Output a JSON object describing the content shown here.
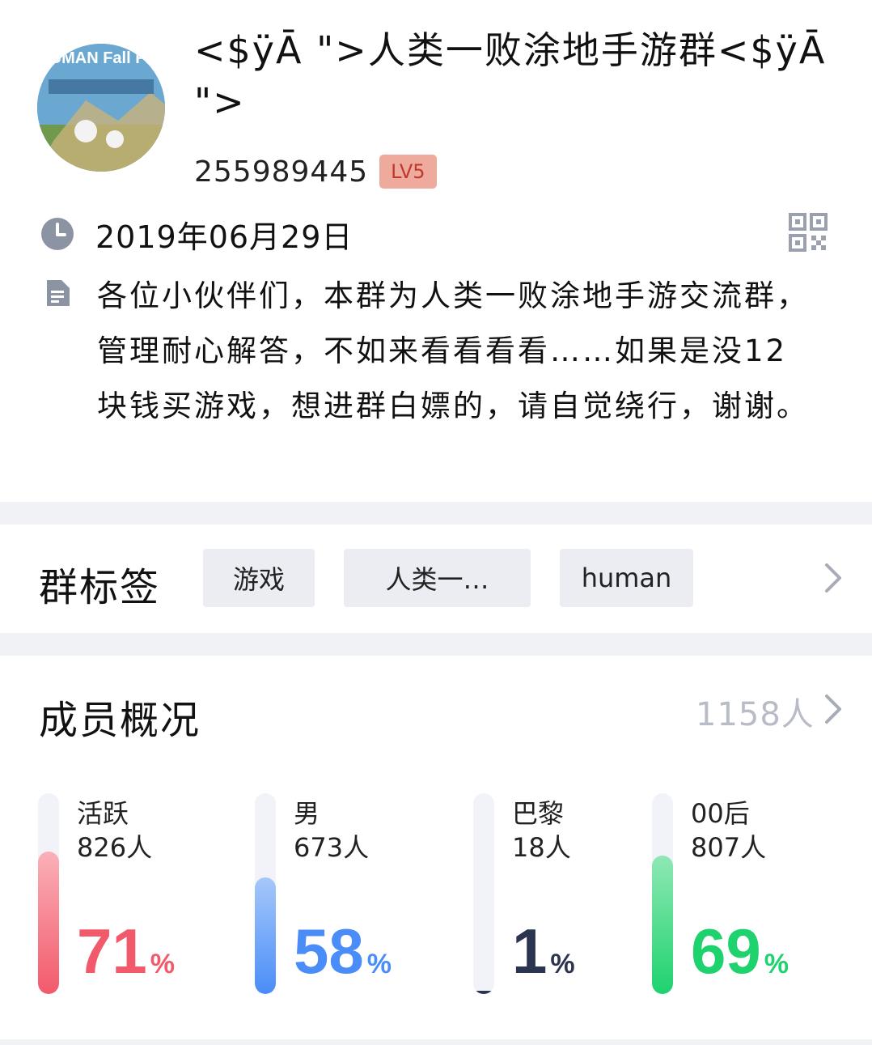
{
  "group": {
    "title": "<$ÿĀ \">人类一败涂地手游群<$ÿĀ \">",
    "id": "255989445",
    "level": "LV5",
    "date": "2019年06月29日",
    "description": "各位小伙伴们，本群为人类一败涂地手游交流群，管理耐心解答，不如来看看看看……如果是没12块钱买游戏，想进群白嫖的，请自觉绕行，谢谢。",
    "avatar_text": "HUMAN Fall Flat"
  },
  "tags": {
    "label": "群标签",
    "items": [
      "游戏",
      "人类一…",
      "human"
    ]
  },
  "members": {
    "label": "成员概况",
    "count": "1158人",
    "stats": [
      {
        "label": "活跃",
        "count": "826人",
        "percent": "71",
        "unit": "%",
        "level": 0.71,
        "color": "#f25a6b",
        "color_light": "#fbb0b8"
      },
      {
        "label": "男",
        "count": "673人",
        "percent": "58",
        "unit": "%",
        "level": 0.58,
        "color": "#4a8df8",
        "color_light": "#a6c8fb"
      },
      {
        "label": "巴黎",
        "count": "18人",
        "percent": "1",
        "unit": "%",
        "level": 0.01,
        "color": "#2b3550",
        "color_light": "#2b3550"
      },
      {
        "label": "00后",
        "count": "807人",
        "percent": "69",
        "unit": "%",
        "level": 0.69,
        "color": "#1ed26e",
        "color_light": "#8fe8b4"
      }
    ]
  },
  "icons": {
    "clock": "clock-icon",
    "qr": "qr-code-icon",
    "doc": "document-icon",
    "chevron": "chevron-right-icon"
  }
}
